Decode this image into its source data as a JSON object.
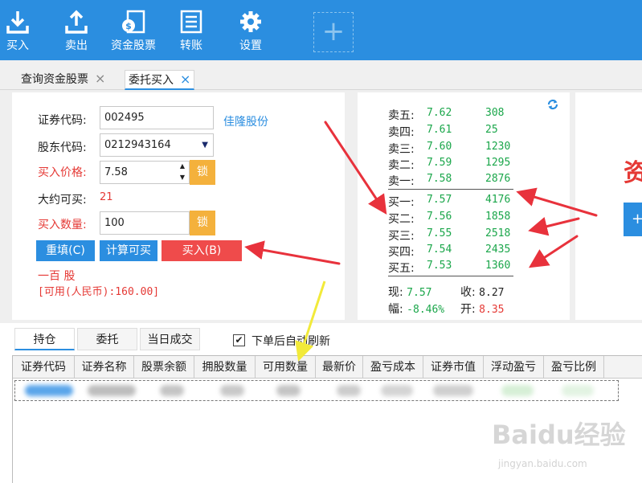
{
  "toolbar": {
    "buy": "买入",
    "sell": "卖出",
    "funds": "资金股票",
    "transfer": "转账",
    "settings": "设置",
    "add": "+"
  },
  "tabs": [
    {
      "label": "查询资金股票",
      "close": "×"
    },
    {
      "label": "委托买入",
      "close": "×"
    }
  ],
  "order": {
    "code_label": "证券代码:",
    "code_value": "002495",
    "stock_name": "佳隆股份",
    "holder_label": "股东代码:",
    "holder_value": "0212943164",
    "price_label": "买入价格:",
    "price_value": "7.58",
    "lock": "锁",
    "approx_label": "大约可买:",
    "approx_value": "21",
    "qty_label": "买入数量:",
    "qty_value": "100",
    "reset_btn": "重填(C)",
    "calc_btn": "计算可买",
    "buy_btn": "买入(B)",
    "qty_words": "一百 股",
    "available": "[可用(人民币):160.00]"
  },
  "quote": {
    "sell": [
      {
        "name": "卖五:",
        "price": "7.62",
        "vol": "308"
      },
      {
        "name": "卖四:",
        "price": "7.61",
        "vol": "25"
      },
      {
        "name": "卖三:",
        "price": "7.60",
        "vol": "1230"
      },
      {
        "name": "卖二:",
        "price": "7.59",
        "vol": "1295"
      },
      {
        "name": "卖一:",
        "price": "7.58",
        "vol": "2876"
      }
    ],
    "buy": [
      {
        "name": "买一:",
        "price": "7.57",
        "vol": "4176"
      },
      {
        "name": "买二:",
        "price": "7.56",
        "vol": "1858"
      },
      {
        "name": "买三:",
        "price": "7.55",
        "vol": "2518"
      },
      {
        "name": "买四:",
        "price": "7.54",
        "vol": "2435"
      },
      {
        "name": "买五:",
        "price": "7.53",
        "vol": "1360"
      }
    ],
    "now_label": "现:",
    "now_value": "7.57",
    "close_label": "收:",
    "close_value": "8.27",
    "change_label": "幅:",
    "change_value": "-8.46%",
    "open_label": "开:",
    "open_value": "8.35"
  },
  "right_partial": "资",
  "bottom": {
    "tabs": [
      "持仓",
      "委托",
      "当日成交"
    ],
    "checkbox_mark": "✔",
    "refresh_label": "下单后自动刷新",
    "columns": [
      "证券代码",
      "证券名称",
      "股票余额",
      "拥股数量",
      "可用数量",
      "最新价",
      "盈亏成本",
      "证券市值",
      "浮动盈亏",
      "盈亏比例"
    ]
  },
  "watermark": "Baidu经验",
  "watermark_sub": "jingyan.baidu.com",
  "colors": {
    "toolbar": "#2b8ee0",
    "lock": "#f4b13c",
    "buy_button": "#ef4b4b",
    "price_green": "#1aa64a",
    "price_red": "#e53935",
    "arrow_red": "#e8323c",
    "arrow_yellow": "#f2ea3a"
  }
}
